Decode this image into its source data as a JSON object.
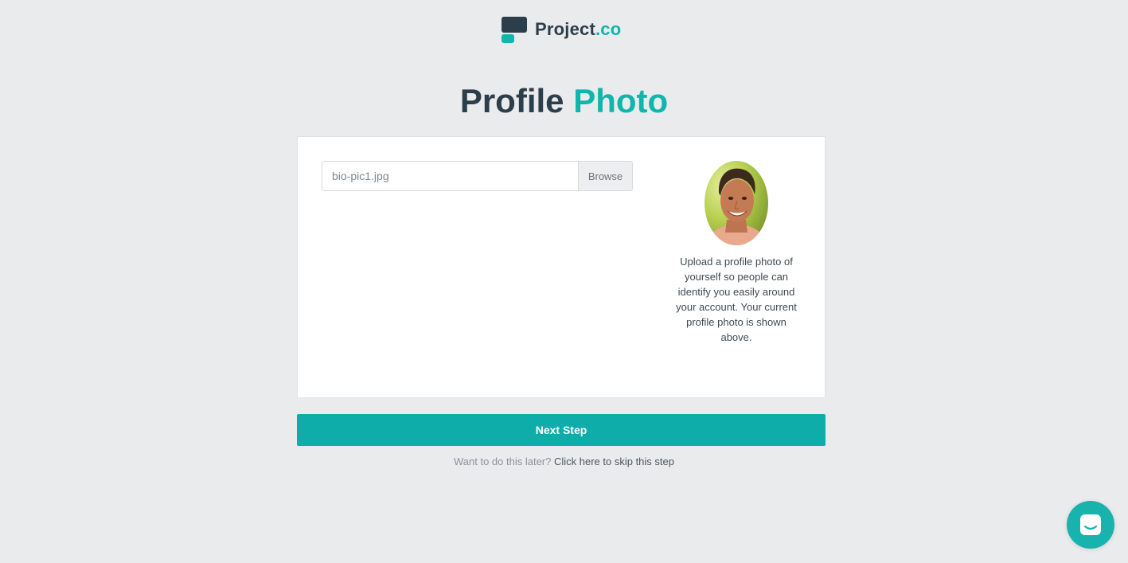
{
  "brand": {
    "name_main": "Project",
    "name_accent": ".co",
    "primary_color": "#2b3e4a",
    "accent_color": "#10b5ac"
  },
  "title": {
    "part1": "Profile",
    "part2": "Photo"
  },
  "upload": {
    "file_value": "bio-pic1.jpg",
    "browse_label": "Browse"
  },
  "profile": {
    "help_text": "Upload a profile photo of yourself so people can identify you easily around your account. Your current profile photo is shown above."
  },
  "actions": {
    "next_label": "Next Step",
    "skip_prompt": "Want to do this later?",
    "skip_link": "Click here to skip this step"
  },
  "chat": {
    "icon": "chat-icon"
  }
}
